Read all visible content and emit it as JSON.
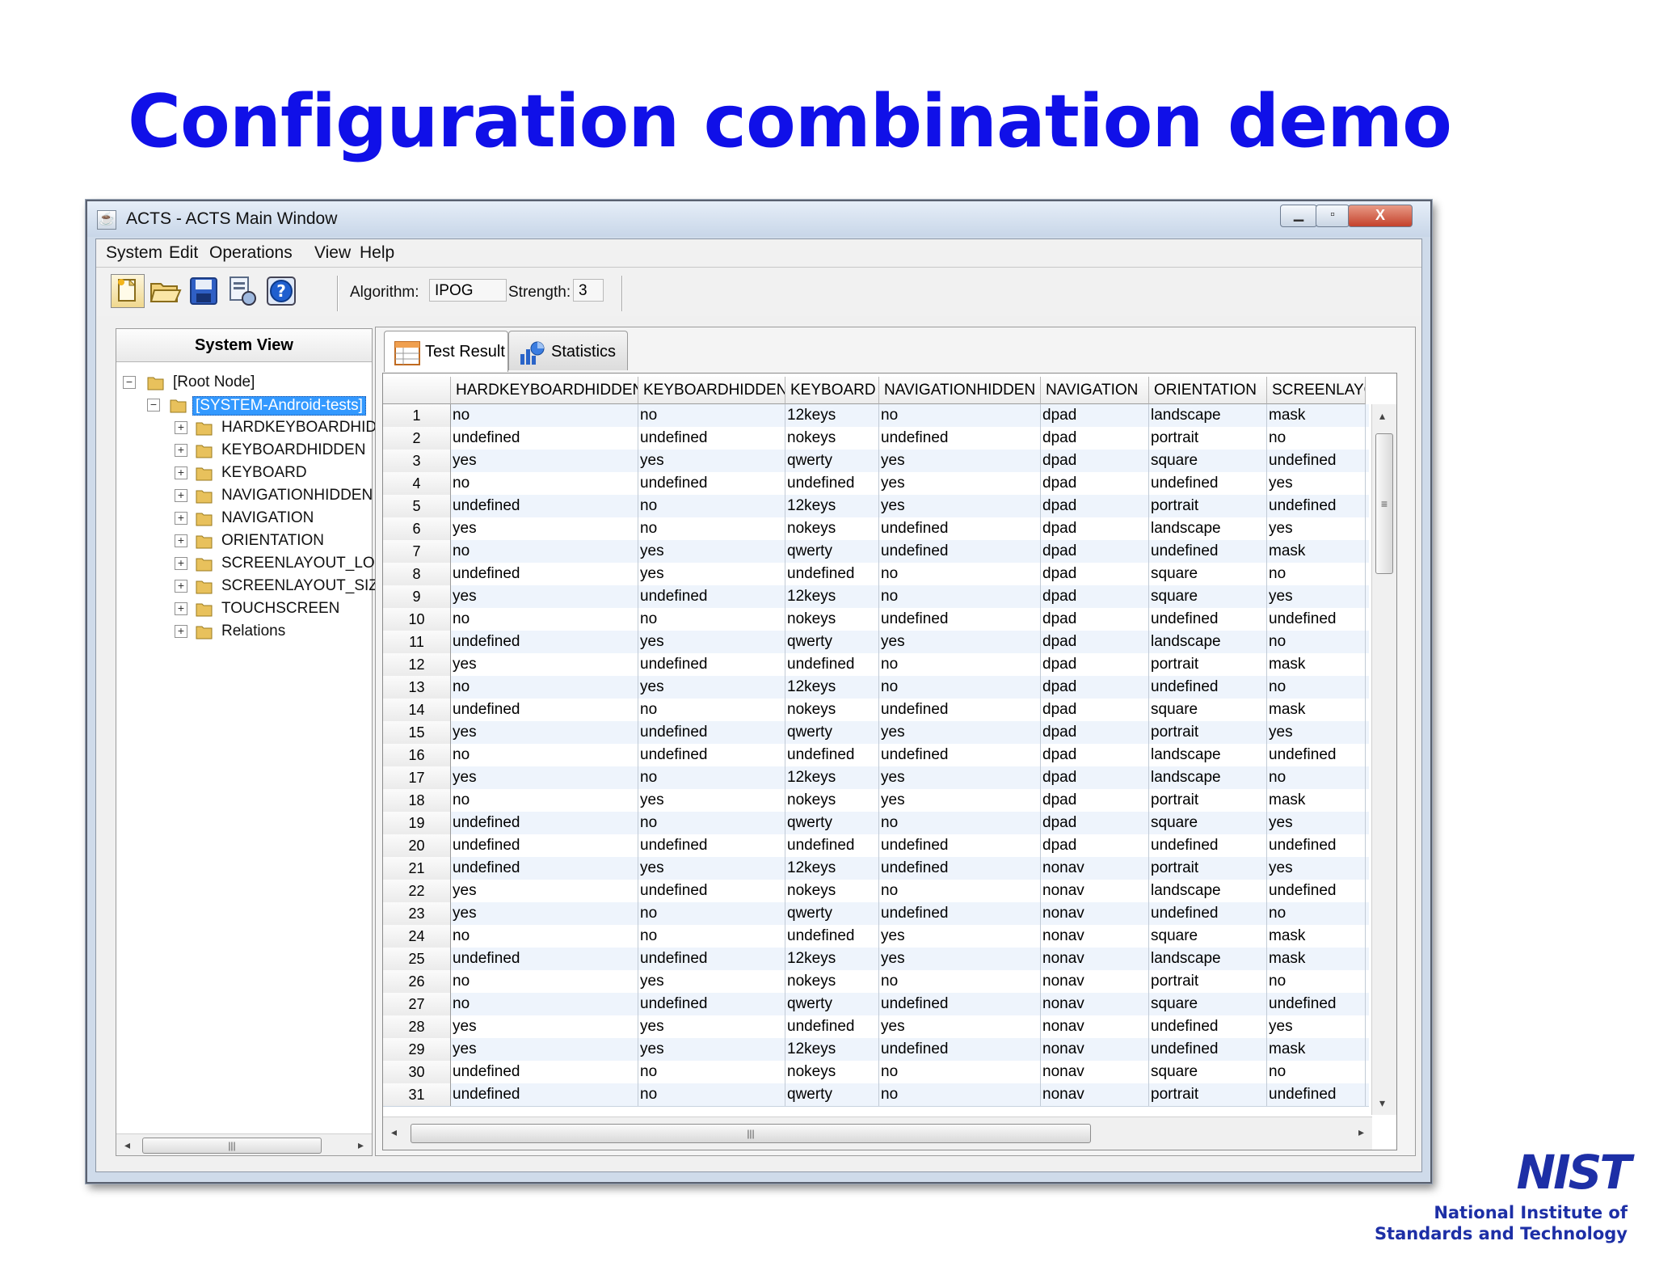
{
  "slide": {
    "title": "Configuration combination demo"
  },
  "window": {
    "title": "ACTS - ACTS Main Window",
    "close_label": "X"
  },
  "menu": [
    "System",
    "Edit",
    "Operations",
    "View",
    "Help"
  ],
  "toolbar": {
    "algorithm_label": "Algorithm:",
    "algorithm_value": "IPOG",
    "strength_label": "Strength:",
    "strength_value": "3"
  },
  "system_view": {
    "header": "System View",
    "root": "[Root Node]",
    "system": "[SYSTEM-Android-tests]",
    "params": [
      "HARDKEYBOARDHIDI",
      "KEYBOARDHIDDEN",
      "KEYBOARD",
      "NAVIGATIONHIDDEN",
      "NAVIGATION",
      "ORIENTATION",
      "SCREENLAYOUT_LON",
      "SCREENLAYOUT_SIZ",
      "TOUCHSCREEN",
      "Relations"
    ]
  },
  "tabs": [
    "Test Result",
    "Statistics"
  ],
  "table": {
    "columns": [
      "HARDKEYBOARDHIDDEN",
      "KEYBOARDHIDDEN",
      "KEYBOARD",
      "NAVIGATIONHIDDEN",
      "NAVIGATION",
      "ORIENTATION",
      "SCREENLAYO"
    ],
    "rows": [
      [
        "no",
        "no",
        "12keys",
        "no",
        "dpad",
        "landscape",
        "mask"
      ],
      [
        "undefined",
        "undefined",
        "nokeys",
        "undefined",
        "dpad",
        "portrait",
        "no"
      ],
      [
        "yes",
        "yes",
        "qwerty",
        "yes",
        "dpad",
        "square",
        "undefined"
      ],
      [
        "no",
        "undefined",
        "undefined",
        "yes",
        "dpad",
        "undefined",
        "yes"
      ],
      [
        "undefined",
        "no",
        "12keys",
        "yes",
        "dpad",
        "portrait",
        "undefined"
      ],
      [
        "yes",
        "no",
        "nokeys",
        "undefined",
        "dpad",
        "landscape",
        "yes"
      ],
      [
        "no",
        "yes",
        "qwerty",
        "undefined",
        "dpad",
        "undefined",
        "mask"
      ],
      [
        "undefined",
        "yes",
        "undefined",
        "no",
        "dpad",
        "square",
        "no"
      ],
      [
        "yes",
        "undefined",
        "12keys",
        "no",
        "dpad",
        "square",
        "yes"
      ],
      [
        "no",
        "no",
        "nokeys",
        "undefined",
        "dpad",
        "undefined",
        "undefined"
      ],
      [
        "undefined",
        "yes",
        "qwerty",
        "yes",
        "dpad",
        "landscape",
        "no"
      ],
      [
        "yes",
        "undefined",
        "undefined",
        "no",
        "dpad",
        "portrait",
        "mask"
      ],
      [
        "no",
        "yes",
        "12keys",
        "no",
        "dpad",
        "undefined",
        "no"
      ],
      [
        "undefined",
        "no",
        "nokeys",
        "undefined",
        "dpad",
        "square",
        "mask"
      ],
      [
        "yes",
        "undefined",
        "qwerty",
        "yes",
        "dpad",
        "portrait",
        "yes"
      ],
      [
        "no",
        "undefined",
        "undefined",
        "undefined",
        "dpad",
        "landscape",
        "undefined"
      ],
      [
        "yes",
        "no",
        "12keys",
        "yes",
        "dpad",
        "landscape",
        "no"
      ],
      [
        "no",
        "yes",
        "nokeys",
        "yes",
        "dpad",
        "portrait",
        "mask"
      ],
      [
        "undefined",
        "no",
        "qwerty",
        "no",
        "dpad",
        "square",
        "yes"
      ],
      [
        "undefined",
        "undefined",
        "undefined",
        "undefined",
        "dpad",
        "undefined",
        "undefined"
      ],
      [
        "undefined",
        "yes",
        "12keys",
        "undefined",
        "nonav",
        "portrait",
        "yes"
      ],
      [
        "yes",
        "undefined",
        "nokeys",
        "no",
        "nonav",
        "landscape",
        "undefined"
      ],
      [
        "yes",
        "no",
        "qwerty",
        "undefined",
        "nonav",
        "undefined",
        "no"
      ],
      [
        "no",
        "no",
        "undefined",
        "yes",
        "nonav",
        "square",
        "mask"
      ],
      [
        "undefined",
        "undefined",
        "12keys",
        "yes",
        "nonav",
        "landscape",
        "mask"
      ],
      [
        "no",
        "yes",
        "nokeys",
        "no",
        "nonav",
        "portrait",
        "no"
      ],
      [
        "no",
        "undefined",
        "qwerty",
        "undefined",
        "nonav",
        "square",
        "undefined"
      ],
      [
        "yes",
        "yes",
        "undefined",
        "yes",
        "nonav",
        "undefined",
        "yes"
      ],
      [
        "yes",
        "yes",
        "12keys",
        "undefined",
        "nonav",
        "undefined",
        "mask"
      ],
      [
        "undefined",
        "no",
        "nokeys",
        "no",
        "nonav",
        "square",
        "no"
      ],
      [
        "undefined",
        "no",
        "qwerty",
        "no",
        "nonav",
        "portrait",
        "undefined"
      ]
    ]
  },
  "logo": {
    "name": "NIST",
    "line1": "National Institute of",
    "line2": "Standards and Technology"
  },
  "colors": {
    "title": "#1010e8",
    "selection": "#3399ff",
    "logo": "#1d2fa6",
    "row_alt": "#eef4fc"
  },
  "icons": [
    "new-file-icon",
    "open-folder-icon",
    "save-icon",
    "export-icon",
    "help-icon",
    "folder-icon",
    "table-icon",
    "statistics-icon"
  ]
}
